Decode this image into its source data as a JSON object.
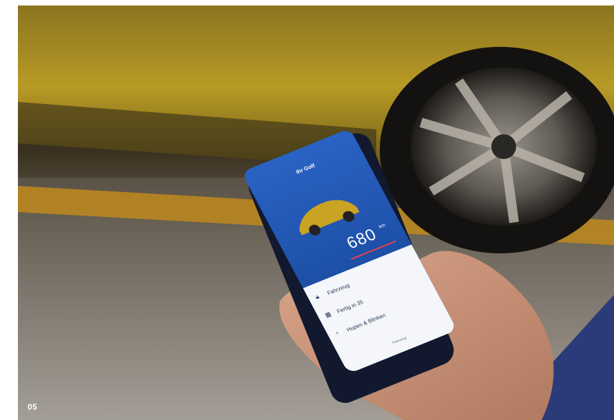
{
  "page_number": "05",
  "app": {
    "title": "Ihr Golf",
    "range_value": "680",
    "range_unit": "km",
    "menu_items": [
      {
        "label": "Fahrzeug",
        "icon": "lock-icon"
      },
      {
        "label": "Fertig in 35",
        "icon": "calendar-icon"
      },
      {
        "label": "Hupen & Blinken",
        "icon": "horn-icon"
      }
    ],
    "tabs": [
      "Fahrzeug"
    ]
  },
  "colors": {
    "car_yellow": "#c9a322",
    "app_blue": "#2a63c4",
    "range_red": "#e7414f"
  }
}
